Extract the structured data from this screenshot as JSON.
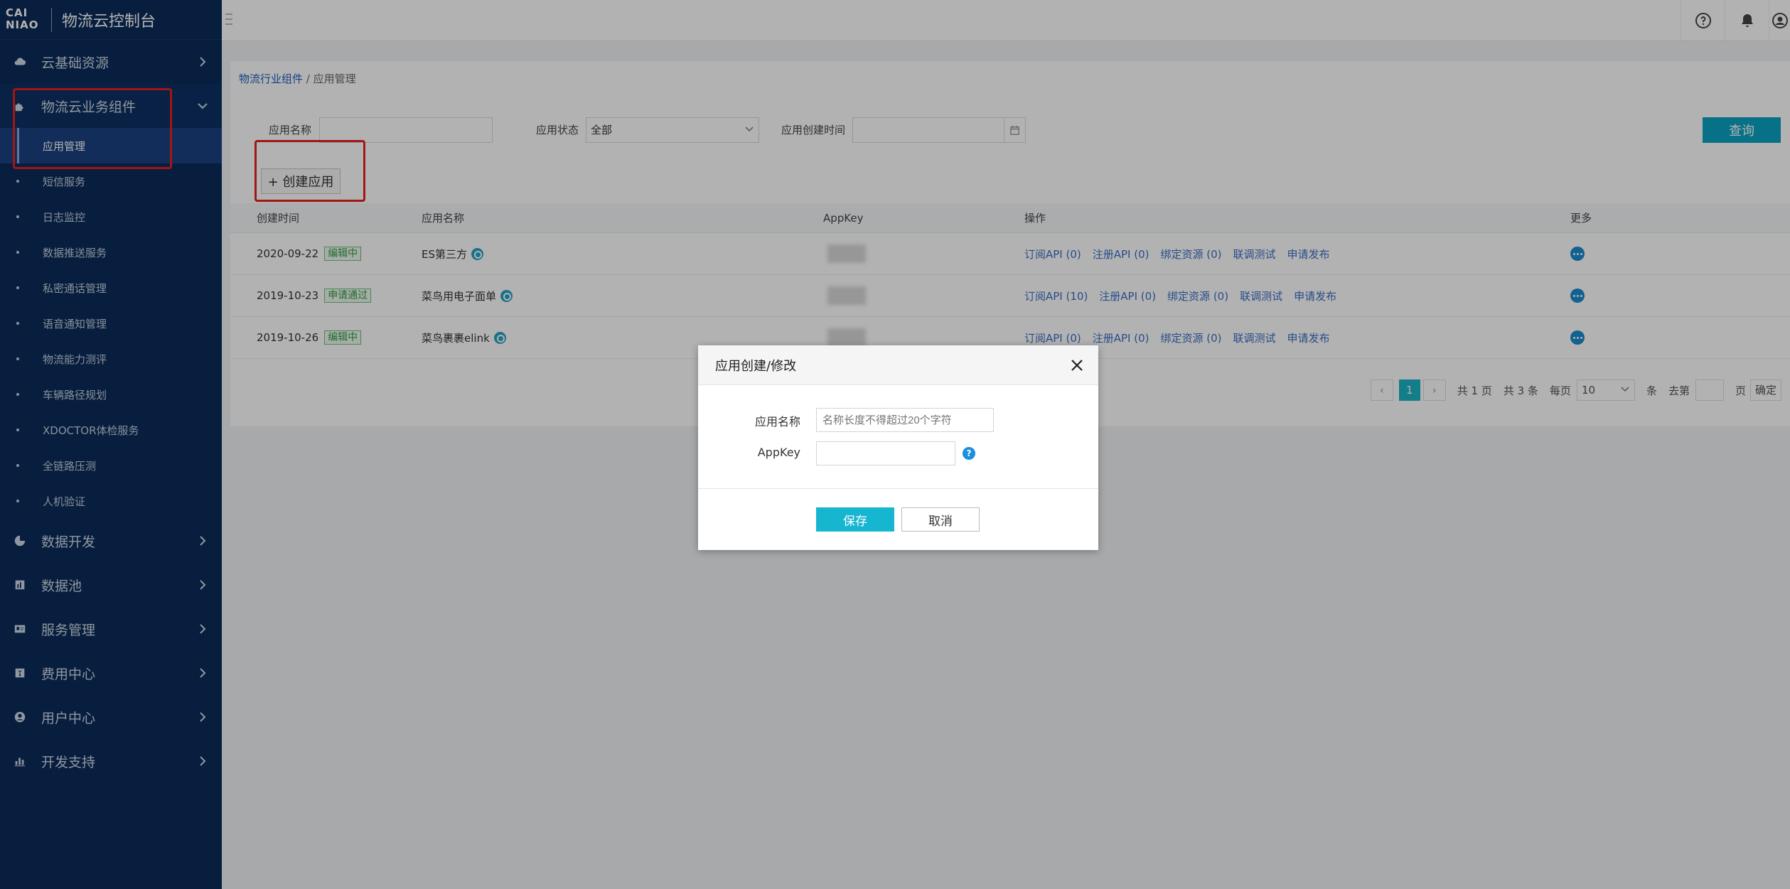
{
  "brand": {
    "logo_line1": "CAI",
    "logo_line2": "NIAO",
    "title": "物流云控制台"
  },
  "sidebar": {
    "groups_top": [
      {
        "label": "云基础资源",
        "icon": "cloud-icon"
      },
      {
        "label": "物流云业务组件",
        "icon": "puzzle-icon"
      }
    ],
    "subitems": [
      {
        "label": "应用管理"
      },
      {
        "label": "短信服务"
      },
      {
        "label": "日志监控"
      },
      {
        "label": "数据推送服务"
      },
      {
        "label": "私密通话管理"
      },
      {
        "label": "语音通知管理"
      },
      {
        "label": "物流能力测评"
      },
      {
        "label": "车辆路径规划"
      },
      {
        "label": "XDOCTOR体检服务"
      },
      {
        "label": "全链路压测"
      },
      {
        "label": "人机验证"
      }
    ],
    "groups_bottom": [
      {
        "label": "数据开发",
        "icon": "pie-chart-icon"
      },
      {
        "label": "数据池",
        "icon": "bar-chart-icon"
      },
      {
        "label": "服务管理",
        "icon": "id-card-icon"
      },
      {
        "label": "费用中心",
        "icon": "yuan-icon"
      },
      {
        "label": "用户中心",
        "icon": "user-icon"
      },
      {
        "label": "开发支持",
        "icon": "stats-icon"
      }
    ]
  },
  "breadcrumb": {
    "parent": "物流行业组件",
    "sep": "/",
    "current": "应用管理"
  },
  "filter": {
    "name_label": "应用名称",
    "name_value": "",
    "status_label": "应用状态",
    "status_value": "全部",
    "time_label": "应用创建时间",
    "time_value": "",
    "query_label": "查询"
  },
  "create_button": "+ 创建应用",
  "table": {
    "headers": {
      "created": "创建时间",
      "name": "应用名称",
      "appkey": "AppKey",
      "ops": "操作",
      "more": "更多"
    },
    "rows": [
      {
        "date": "2020-09-22",
        "status": "编辑中",
        "name": "ES第三方",
        "ops": [
          "订阅API (0)",
          "注册API (0)",
          "绑定资源 (0)",
          "联调测试",
          "申请发布"
        ]
      },
      {
        "date": "2019-10-23",
        "status": "申请通过",
        "name": "菜鸟用电子面单",
        "ops": [
          "订阅API (10)",
          "注册API (0)",
          "绑定资源 (0)",
          "联调测试",
          "申请发布"
        ]
      },
      {
        "date": "2019-10-26",
        "status": "编辑中",
        "name": "菜鸟裹裹elink",
        "ops": [
          "订阅API (0)",
          "注册API (0)",
          "绑定资源 (0)",
          "联调测试",
          "申请发布"
        ]
      }
    ]
  },
  "pagination": {
    "current": "1",
    "total_pages": "共 1 页",
    "total_items": "共 3 条",
    "per_page_label": "每页",
    "per_page_value": "10",
    "per_page_unit": "条",
    "goto_label": "去第",
    "goto_unit": "页",
    "confirm": "确定"
  },
  "modal": {
    "title": "应用创建/修改",
    "name_label": "应用名称",
    "name_placeholder": "名称长度不得超过20个字符",
    "appkey_label": "AppKey",
    "appkey_value": "",
    "help": "?",
    "save": "保存",
    "cancel": "取消"
  },
  "colors": {
    "sidebar": "#0b2b5a",
    "accent": "#16b6d1",
    "highlight": "#e8201e"
  }
}
